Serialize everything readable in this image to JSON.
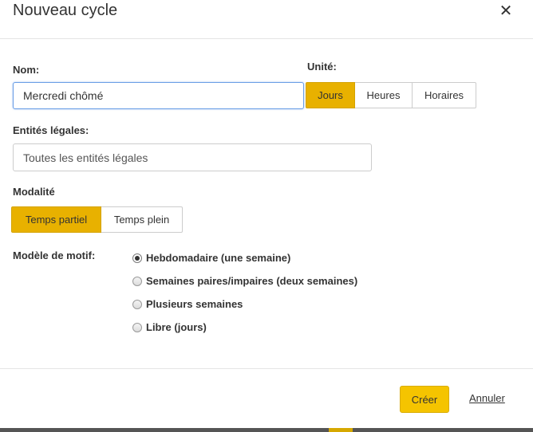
{
  "dialog": {
    "title": "Nouveau cycle",
    "close_glyph": "✕"
  },
  "form": {
    "name": {
      "label": "Nom:",
      "value": "Mercredi chômé"
    },
    "unit": {
      "label": "Unité:",
      "options": [
        "Jours",
        "Heures",
        "Horaires"
      ],
      "selected": "Jours"
    },
    "legal_entities": {
      "label": "Entités légales:",
      "placeholder": "Toutes les entités légales"
    },
    "modality": {
      "label": "Modalité",
      "options": [
        "Temps partiel",
        "Temps plein"
      ],
      "selected": "Temps partiel"
    },
    "pattern": {
      "label": "Modèle de motif:",
      "options": [
        "Hebdomadaire (une semaine)",
        "Semaines paires/impaires (deux semaines)",
        "Plusieurs semaines",
        "Libre (jours)"
      ],
      "selected": "Hebdomadaire (une semaine)"
    }
  },
  "footer": {
    "create_label": "Créer",
    "cancel_label": "Annuler"
  },
  "colors": {
    "accent": "#e8b100",
    "primary_button": "#f5c400",
    "focus_border": "#6a9ee6"
  }
}
